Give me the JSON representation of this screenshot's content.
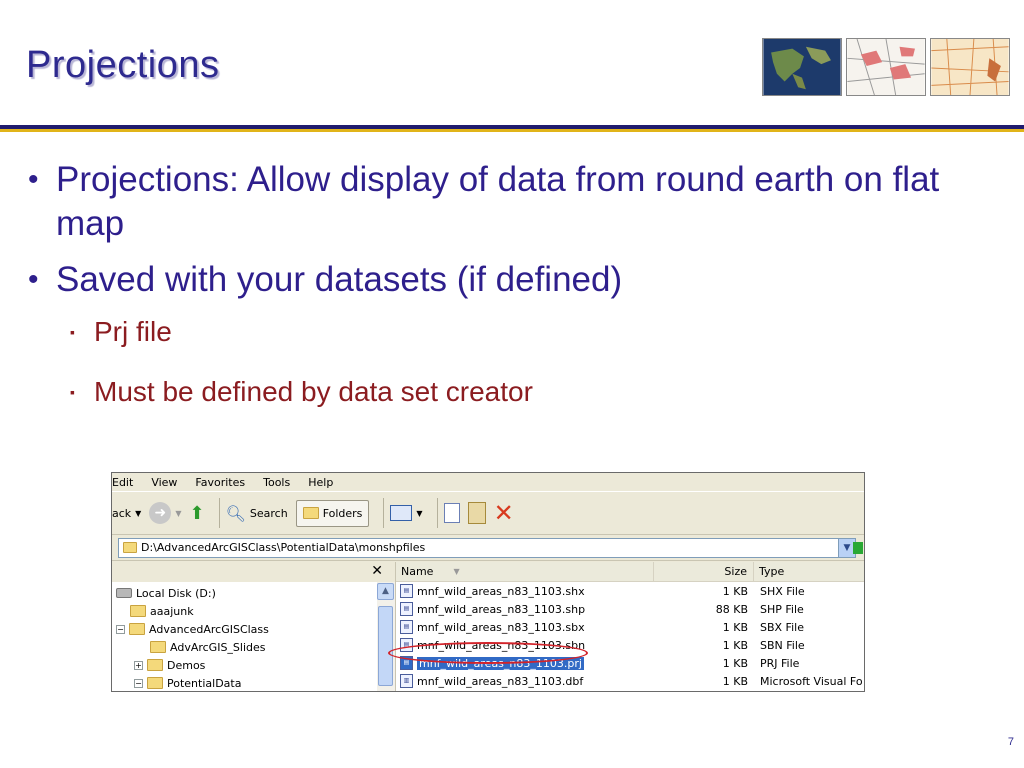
{
  "slide": {
    "title": "Projections",
    "page_number": "7"
  },
  "bullets": [
    {
      "text": "Projections:  Allow display of data from round earth on flat map"
    },
    {
      "text": "Saved with your datasets (if defined)"
    }
  ],
  "sub_bullets": [
    {
      "text": "Prj file"
    },
    {
      "text": "Must be defined by data set creator"
    }
  ],
  "thumbnails": [
    "satellite-map-thumb",
    "road-map-thumb",
    "topo-map-thumb"
  ],
  "explorer": {
    "menu": [
      "Edit",
      "View",
      "Favorites",
      "Tools",
      "Help"
    ],
    "toolbar": {
      "back_label": "ack",
      "search_label": "Search",
      "folders_label": "Folders"
    },
    "address": "D:\\AdvancedArcGISClass\\PotentialData\\monshpfiles",
    "tree": [
      {
        "label": "Local Disk (D:)",
        "kind": "drive"
      },
      {
        "label": "aaajunk",
        "kind": "folder"
      },
      {
        "label": "AdvancedArcGISClass",
        "kind": "folder",
        "expander": "−"
      },
      {
        "label": "AdvArcGIS_Slides",
        "kind": "folder"
      },
      {
        "label": "Demos",
        "kind": "folder",
        "expander": "+"
      },
      {
        "label": "PotentialData",
        "kind": "folder",
        "expander": "−"
      }
    ],
    "columns": {
      "name": "Name",
      "size": "Size",
      "type": "Type"
    },
    "files": [
      {
        "name": "mnf_wild_areas_n83_1103.shx",
        "size": "1 KB",
        "type": "SHX File"
      },
      {
        "name": "mnf_wild_areas_n83_1103.shp",
        "size": "88 KB",
        "type": "SHP File"
      },
      {
        "name": "mnf_wild_areas_n83_1103.sbx",
        "size": "1 KB",
        "type": "SBX File"
      },
      {
        "name": "mnf_wild_areas_n83_1103.sbn",
        "size": "1 KB",
        "type": "SBN File"
      },
      {
        "name": "mnf_wild_areas_n83_1103.prj",
        "size": "1 KB",
        "type": "PRJ File",
        "selected": true
      },
      {
        "name": "mnf_wild_areas_n83_1103.dbf",
        "size": "1 KB",
        "type": "Microsoft Visual Fo"
      }
    ]
  },
  "colors": {
    "title": "#2e2a8f",
    "bullet": "#2e1f8c",
    "sub_bullet": "#8b1c20",
    "rule_navy": "#1f1b6e",
    "rule_gold": "#e1b419",
    "highlight_ellipse": "#d2232a"
  }
}
